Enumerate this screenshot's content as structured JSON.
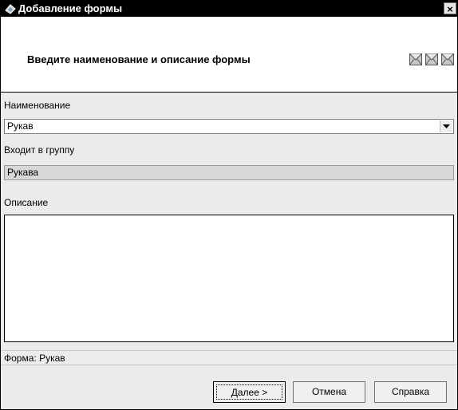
{
  "window": {
    "title": "Добавление формы",
    "close_label": "×"
  },
  "header": {
    "text": "Введите наименование и описание формы",
    "icons": [
      "envelope-icon",
      "envelope-icon",
      "envelope-icon"
    ]
  },
  "form": {
    "name_label": "Наименование",
    "name_value": "Рукав",
    "group_label": "Входит в группу",
    "group_value": "Рукава",
    "description_label": "Описание",
    "description_value": ""
  },
  "status": {
    "text": "Форма: Рукав"
  },
  "buttons": {
    "next": "Далее >",
    "cancel": "Отмена",
    "help": "Справка"
  }
}
